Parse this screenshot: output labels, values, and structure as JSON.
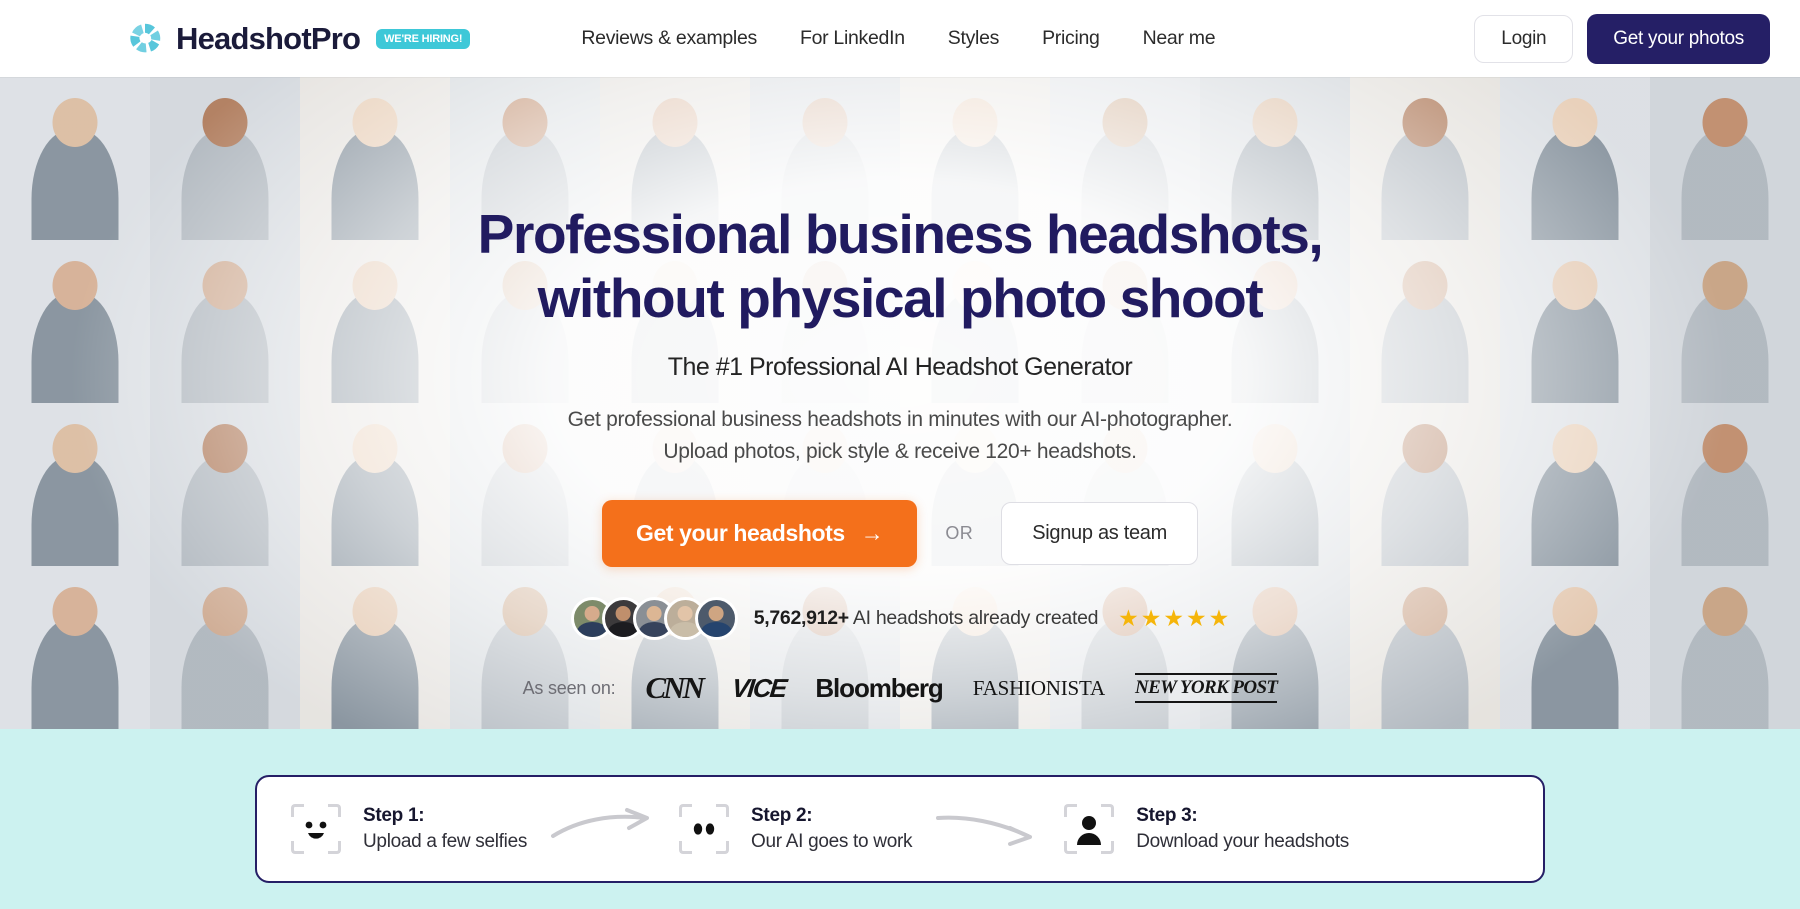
{
  "header": {
    "brand_name": "HeadshotPro",
    "hiring_badge": "WE'RE HIRING!",
    "nav": [
      {
        "label": "Reviews & examples",
        "name": "nav-reviews-examples"
      },
      {
        "label": "For LinkedIn",
        "name": "nav-for-linkedin"
      },
      {
        "label": "Styles",
        "name": "nav-styles"
      },
      {
        "label": "Pricing",
        "name": "nav-pricing"
      },
      {
        "label": "Near me",
        "name": "nav-near-me"
      }
    ],
    "login_label": "Login",
    "get_photos_label": "Get your photos"
  },
  "hero": {
    "headline_line1": "Professional business headshots,",
    "headline_line2": "without physical photo shoot",
    "subhead": "The #1 Professional AI Headshot Generator",
    "description": "Get professional business headshots in minutes with our AI-photographer. Upload photos, pick style & receive 120+ headshots.",
    "cta_primary": "Get your headshots",
    "cta_arrow": "→",
    "or_label": "OR",
    "cta_secondary": "Signup as team",
    "proof_count": "5,762,912+",
    "proof_text": "AI headshots already created",
    "star_count": 5,
    "star_glyph": "★",
    "as_seen_label": "As seen on:",
    "press": [
      {
        "name": "press-logo-cnn",
        "label": "CNN",
        "class": "press-cnn"
      },
      {
        "name": "press-logo-vice",
        "label": "VICE",
        "class": "press-vice"
      },
      {
        "name": "press-logo-bloomberg",
        "label": "Bloomberg",
        "class": "press-bloomberg"
      },
      {
        "name": "press-logo-fashionista",
        "label": "FASHIONISTA",
        "class": "press-fashionista"
      },
      {
        "name": "press-logo-new-york-post",
        "label": "NEW YORK POST",
        "class": "press-nypost"
      }
    ]
  },
  "steps": [
    {
      "title": "Step 1:",
      "subtitle": "Upload a few selfies",
      "icon": "face-smile-scan-icon"
    },
    {
      "title": "Step 2:",
      "subtitle": "Our AI goes to work",
      "icon": "face-eyes-scan-icon"
    },
    {
      "title": "Step 3:",
      "subtitle": "Download your headshots",
      "icon": "person-portrait-scan-icon"
    }
  ],
  "colors": {
    "brand_navy": "#251f66",
    "accent_orange": "#f4701b",
    "logo_teal": "#3ec8d8",
    "mint_band": "#ccf2f0",
    "star_gold": "#f5b50a",
    "headline_navy": "#211b60"
  }
}
